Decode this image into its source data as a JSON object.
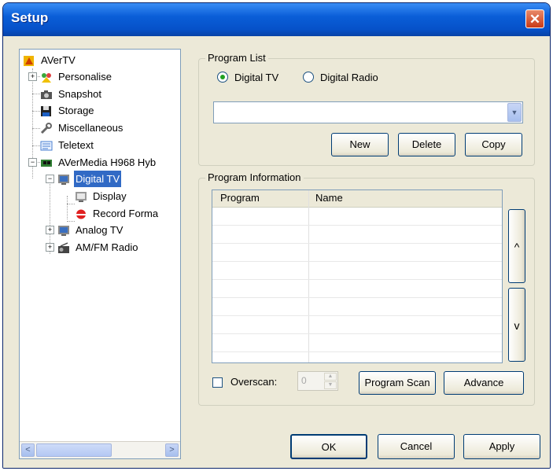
{
  "window": {
    "title": "Setup",
    "close_glyph": "✕"
  },
  "tree": {
    "items": [
      {
        "label": "AVerTV",
        "icon": "avertv-icon"
      },
      {
        "label": "Personalise",
        "icon": "personalise-icon"
      },
      {
        "label": "Snapshot",
        "icon": "camera-icon"
      },
      {
        "label": "Storage",
        "icon": "floppy-disk-icon"
      },
      {
        "label": "Miscellaneous",
        "icon": "wrench-icon"
      },
      {
        "label": "Teletext",
        "icon": "teletext-icon"
      },
      {
        "label": "AVerMedia H968 Hyb",
        "icon": "tuner-card-icon"
      },
      {
        "label": "Digital TV",
        "icon": "tv-icon",
        "selected": true
      },
      {
        "label": "Display",
        "icon": "display-icon"
      },
      {
        "label": "Record Forma",
        "icon": "record-icon"
      },
      {
        "label": "Analog TV",
        "icon": "tv-icon"
      },
      {
        "label": "AM/FM Radio",
        "icon": "radio-icon"
      }
    ],
    "expander_plus": "+",
    "expander_minus": "−",
    "scroll_left": "<",
    "scroll_right": ">"
  },
  "program_list": {
    "label": "Program List",
    "radio_digital_tv": "Digital TV",
    "radio_digital_radio": "Digital Radio",
    "selected_radio": "Digital TV",
    "combo_value": "",
    "combo_arrow": "▼",
    "new_button": "New",
    "delete_button": "Delete",
    "copy_button": "Copy"
  },
  "program_information": {
    "label": "Program Information",
    "columns": [
      "Program",
      "Name"
    ],
    "rows": [],
    "move_up": "^",
    "move_down": "v"
  },
  "controls": {
    "overscan_label": "Overscan:",
    "overscan_checked": false,
    "overscan_value": "0",
    "spin_up": "▲",
    "spin_down": "▼",
    "program_scan_button": "Program Scan",
    "advance_button": "Advance"
  },
  "footer": {
    "ok_button": "OK",
    "cancel_button": "Cancel",
    "apply_button": "Apply"
  },
  "colors": {
    "titlebar": "#0a5ed8",
    "selection": "#316ac5",
    "window_bg": "#ece9d8"
  }
}
